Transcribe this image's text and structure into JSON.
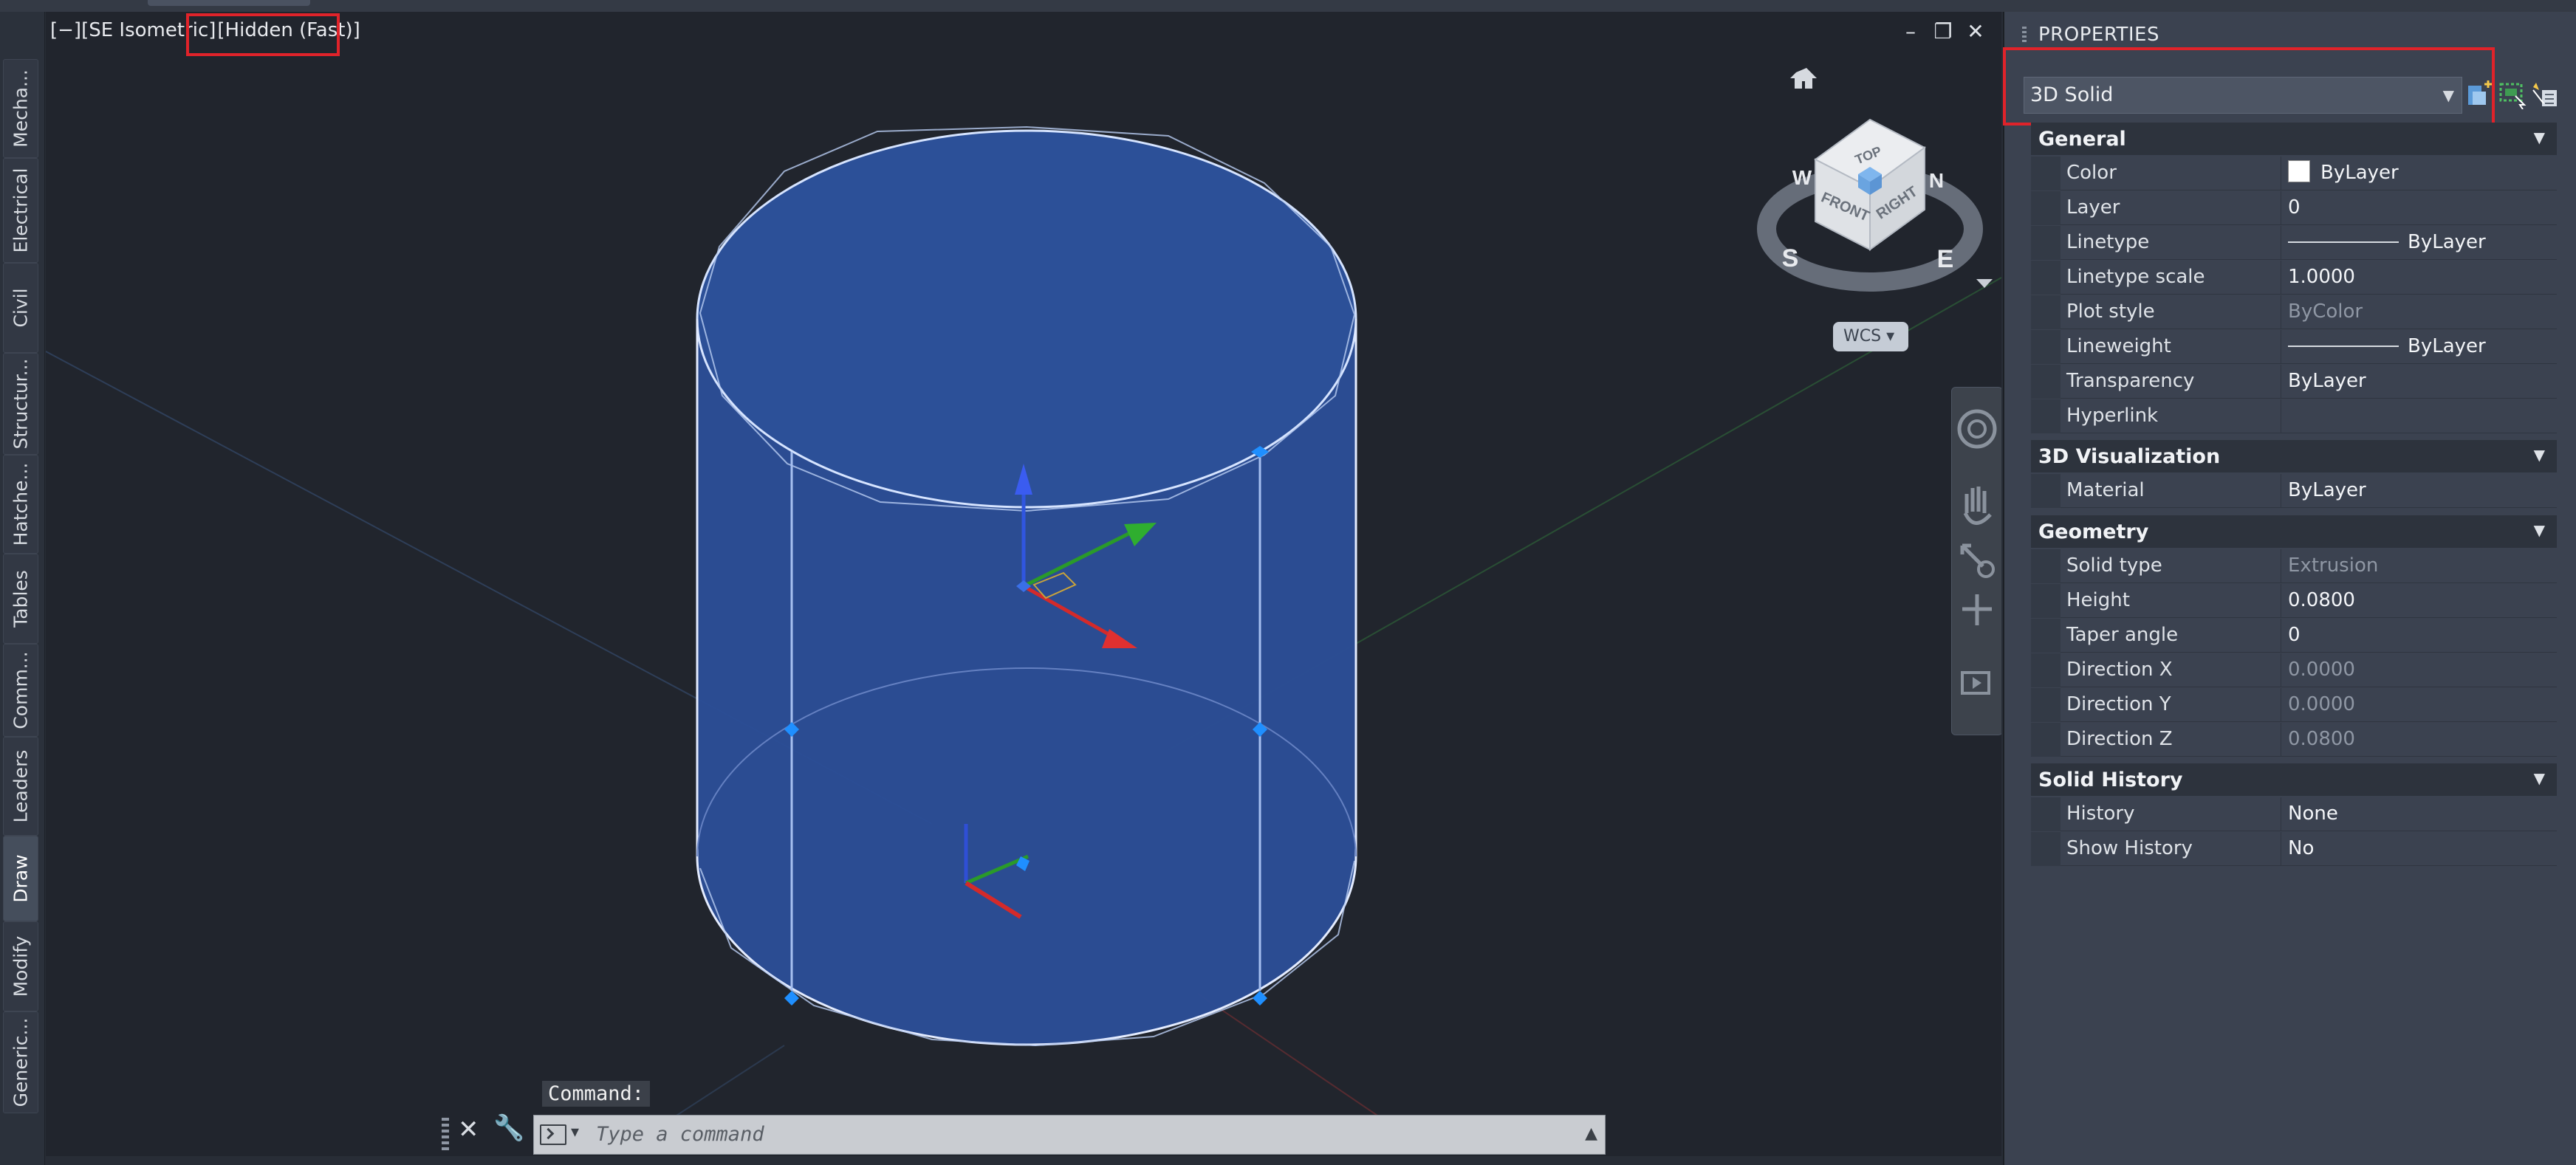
{
  "palette": {
    "tabs": [
      {
        "label": "Mecha..."
      },
      {
        "label": "Electrical"
      },
      {
        "label": "Civil"
      },
      {
        "label": "Structur..."
      },
      {
        "label": "Hatche..."
      },
      {
        "label": "Tables"
      },
      {
        "label": "Comm..."
      },
      {
        "label": "Leaders"
      },
      {
        "label": "Draw"
      },
      {
        "label": "Modify"
      },
      {
        "label": "Generic..."
      }
    ],
    "active_tab": "Draw"
  },
  "viewport": {
    "label_prefix": "[−][SE Isometric]",
    "visual_style": "[Hidden (Fast)]",
    "controls": {
      "minimize": "–",
      "restore": "❐",
      "close": "✕"
    }
  },
  "viewcube": {
    "faces": {
      "top": "TOP",
      "front": "FRONT",
      "right": "RIGHT"
    },
    "compass": {
      "n": "N",
      "s": "S",
      "e": "E",
      "w": "W"
    },
    "ucs_label": "WCS ▾"
  },
  "command": {
    "history": "Command:",
    "placeholder": "Type a command"
  },
  "properties": {
    "title": "PROPERTIES",
    "object_type": "3D Solid",
    "sections": {
      "general": {
        "title": "General",
        "rows": [
          {
            "label": "Color",
            "value": "ByLayer"
          },
          {
            "label": "Layer",
            "value": "0"
          },
          {
            "label": "Linetype",
            "value": "ByLayer"
          },
          {
            "label": "Linetype scale",
            "value": "1.0000"
          },
          {
            "label": "Plot style",
            "value": "ByColor"
          },
          {
            "label": "Lineweight",
            "value": "ByLayer"
          },
          {
            "label": "Transparency",
            "value": "ByLayer"
          },
          {
            "label": "Hyperlink",
            "value": ""
          }
        ]
      },
      "visualization": {
        "title": "3D Visualization",
        "rows": [
          {
            "label": "Material",
            "value": "ByLayer"
          }
        ]
      },
      "geometry": {
        "title": "Geometry",
        "rows": [
          {
            "label": "Solid type",
            "value": "Extrusion"
          },
          {
            "label": "Height",
            "value": "0.0800"
          },
          {
            "label": "Taper angle",
            "value": "0"
          },
          {
            "label": "Direction X",
            "value": "0.0000"
          },
          {
            "label": "Direction Y",
            "value": "0.0000"
          },
          {
            "label": "Direction Z",
            "value": "0.0800"
          }
        ]
      },
      "history": {
        "title": "Solid History",
        "rows": [
          {
            "label": "History",
            "value": "None"
          },
          {
            "label": "Show History",
            "value": "No"
          }
        ]
      }
    }
  },
  "colors": {
    "solid_fill": "#2b4d96",
    "solid_edge": "#cfe0ff",
    "grip": "#1f8fff",
    "highlight": "#e0232a",
    "x_axis": "#d42a2a",
    "y_axis": "#2a9a2a",
    "z_axis": "#2f4fd6"
  }
}
